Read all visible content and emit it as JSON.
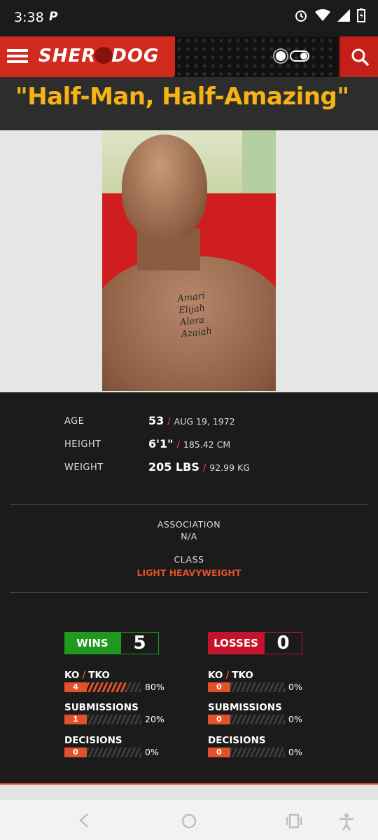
{
  "status_bar": {
    "time": "3:38",
    "app_icon": "paypal-icon"
  },
  "header": {
    "logo": "SHERDOG",
    "logo_left": "SHER",
    "logo_right": "DOG"
  },
  "fighter": {
    "nickname": "\"Half-Man, Half-Amazing\"",
    "tattoo_lines": [
      "Amari",
      "Elijah",
      "Alera",
      "Azaiah"
    ]
  },
  "stats": [
    {
      "label": "AGE",
      "primary": "53",
      "secondary": "AUG 19, 1972"
    },
    {
      "label": "HEIGHT",
      "primary": "6'1\"",
      "secondary": "185.42 CM"
    },
    {
      "label": "WEIGHT",
      "primary": "205 LBS",
      "secondary": "92.99 KG"
    }
  ],
  "association": {
    "label": "ASSOCIATION",
    "value": "N/A"
  },
  "weight_class": {
    "label": "CLASS",
    "value": "LIGHT HEAVYWEIGHT"
  },
  "wins": {
    "label": "WINS",
    "total": "5",
    "methods": [
      {
        "name": "KO",
        "name2": "TKO",
        "count": "4",
        "percent": "80%",
        "fraction": 0.8
      },
      {
        "name": "SUBMISSIONS",
        "count": "1",
        "percent": "20%",
        "fraction": 0.2
      },
      {
        "name": "DECISIONS",
        "count": "0",
        "percent": "0%",
        "fraction": 0
      }
    ]
  },
  "losses": {
    "label": "LOSSES",
    "total": "0",
    "methods": [
      {
        "name": "KO",
        "name2": "TKO",
        "count": "0",
        "percent": "0%",
        "fraction": 0
      },
      {
        "name": "SUBMISSIONS",
        "count": "0",
        "percent": "0%",
        "fraction": 0
      },
      {
        "name": "DECISIONS",
        "count": "0",
        "percent": "0%",
        "fraction": 0
      }
    ]
  },
  "colors": {
    "accent": "#e2522a",
    "win": "#1f9a1f",
    "loss": "#c4132a",
    "nickname": "#f6b314"
  }
}
